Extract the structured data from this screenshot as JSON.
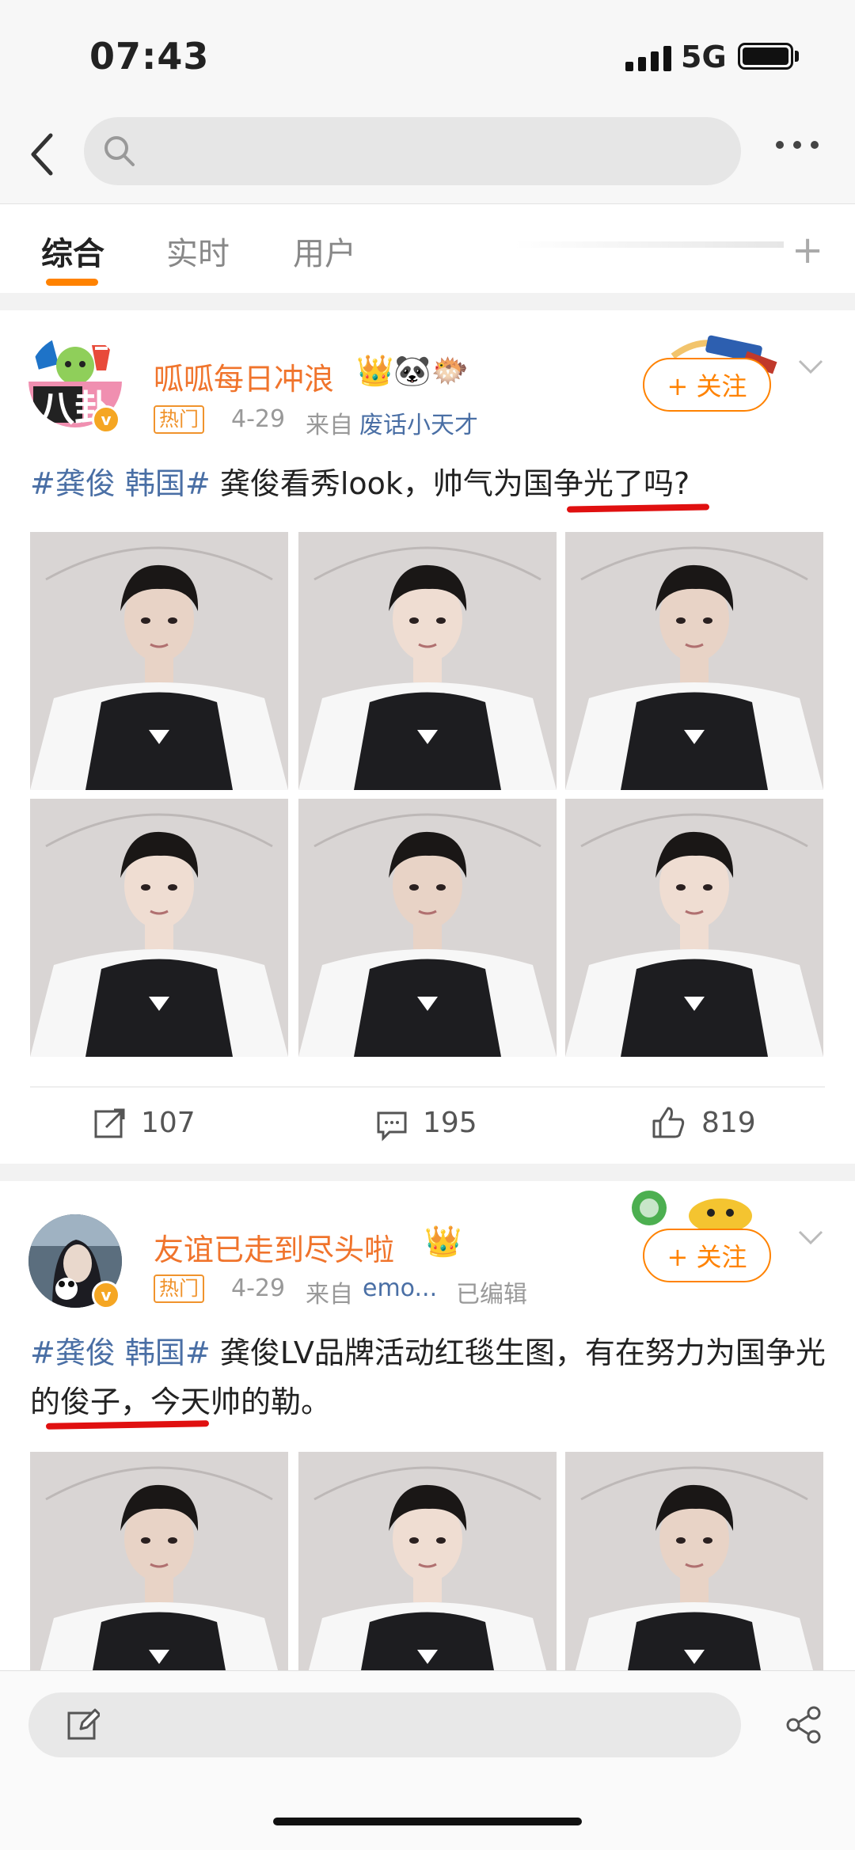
{
  "status_bar": {
    "time": "07:43",
    "network": "5G"
  },
  "search": {
    "placeholder": ""
  },
  "tabs": [
    {
      "label": "综合",
      "active": true
    },
    {
      "label": "实时",
      "active": false
    },
    {
      "label": "用户",
      "active": false
    }
  ],
  "tab_add": "+",
  "posts": [
    {
      "username": "呱呱每日冲浪",
      "hot_badge": "热门",
      "date": "4-29",
      "source_prefix": "来自",
      "source": "废话小天才",
      "edited": "",
      "follow_label": "+ 关注",
      "hashtag": "#龚俊 韩国#",
      "text_before": " 龚俊看秀look，帅气",
      "text_underlined": "为国争光了",
      "text_after": "吗?",
      "actions": {
        "repost": "107",
        "comment": "195",
        "like": "819"
      }
    },
    {
      "username": "友谊已走到尽头啦",
      "hot_badge": "热门",
      "date": "4-29",
      "source_prefix": "来自",
      "source": "emo...",
      "edited": "已编辑",
      "follow_label": "+ 关注",
      "hashtag": "#龚俊 韩国#",
      "text_before": " 龚俊LV品牌活动红毯生图，有在努力",
      "text_underlined": "为国争光的",
      "text_after": "俊子，今天帅的勒。"
    }
  ],
  "avatar_text": "八卦",
  "colors": {
    "accent": "#ff8200",
    "username": "#f0742c",
    "link": "#4a6fa5",
    "underline": "#e01010"
  }
}
